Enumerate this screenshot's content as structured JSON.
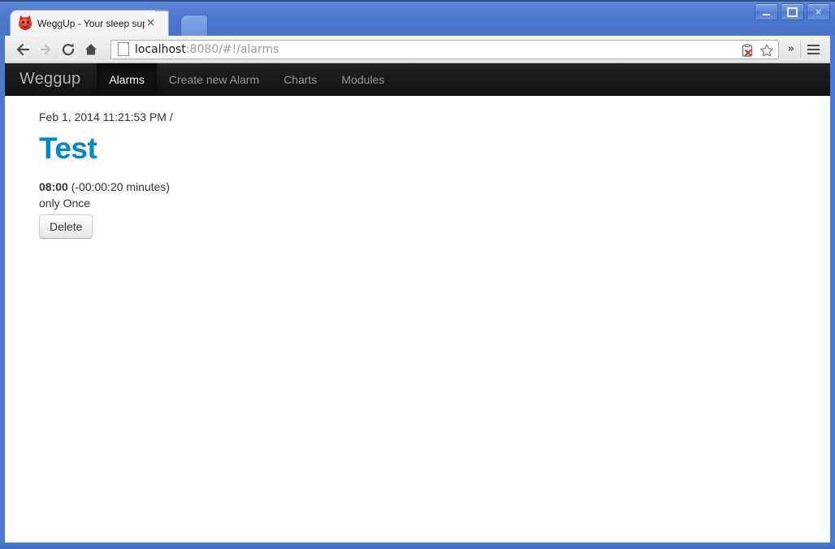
{
  "window": {
    "buttons": {
      "minimize": "minimize",
      "maximize": "maximize",
      "close": "×"
    }
  },
  "browser": {
    "tab": {
      "title": "WeggUp - Your sleep supp",
      "favicon": "devil-face-icon",
      "close_label": "×"
    },
    "new_tab_label": "",
    "toolbar": {
      "back_icon": "back-arrow-icon",
      "forward_icon": "forward-arrow-icon",
      "reload_icon": "reload-icon",
      "home_icon": "home-icon",
      "page_icon": "page-document-icon",
      "url_host": "localhost",
      "url_rest": ":8080/#!/alarms",
      "blocked_plugin_icon": "blocked-plugin-icon",
      "bookmark_icon": "star-bookmark-icon",
      "overflow_label": "»",
      "menu_icon": "hamburger-menu-icon"
    }
  },
  "page": {
    "navbar": {
      "brand": "Weggup",
      "links": [
        {
          "label": "Alarms",
          "active": true
        },
        {
          "label": "Create new Alarm",
          "active": false
        },
        {
          "label": "Charts",
          "active": false
        },
        {
          "label": "Modules",
          "active": false
        }
      ]
    },
    "alarm": {
      "meta": "Feb 1, 2014 11:21:53 PM /",
      "title": "Test",
      "time": "08:00",
      "countdown": "(-00:00:20 minutes)",
      "repeat": "only Once",
      "delete_label": "Delete"
    }
  },
  "colors": {
    "titlebar_blue": "#4a79cf",
    "navbar_dark": "#111111",
    "link_blue": "#0088cc",
    "text_dark": "#333333"
  }
}
